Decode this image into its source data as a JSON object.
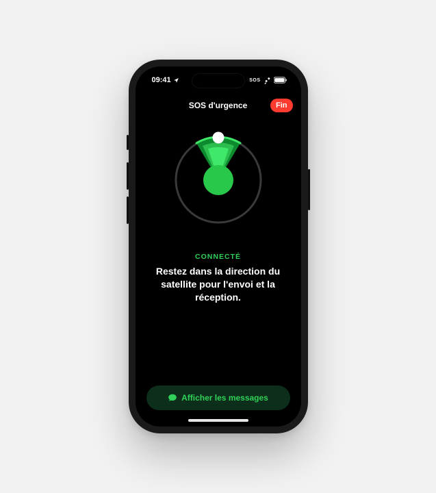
{
  "status_bar": {
    "time": "09:41",
    "sos_label": "SOS"
  },
  "nav": {
    "title": "SOS d'urgence",
    "end_label": "Fin"
  },
  "connection": {
    "status_label": "CONNECTÉ",
    "instruction": "Restez dans la direction du satellite pour l'envoi et la réception."
  },
  "actions": {
    "show_messages": "Afficher les messages"
  },
  "colors": {
    "accent_green": "#30d158",
    "end_red": "#ff3b30"
  }
}
